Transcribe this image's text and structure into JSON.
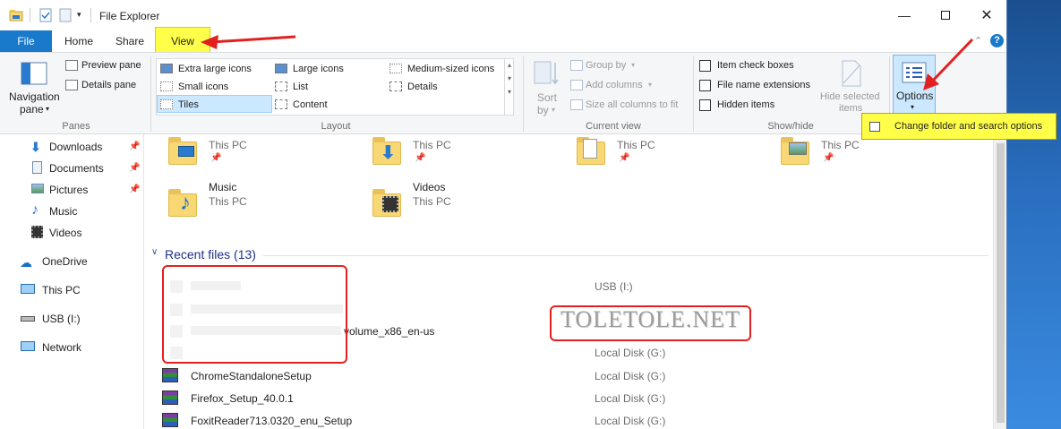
{
  "window": {
    "title": "File Explorer"
  },
  "tabs": {
    "file": "File",
    "home": "Home",
    "share": "Share",
    "view": "View"
  },
  "ribbon": {
    "panes": {
      "label": "Panes",
      "navigation_pane": "Navigation",
      "navigation_pane_2": "pane",
      "preview_pane": "Preview pane",
      "details_pane": "Details pane"
    },
    "layout": {
      "label": "Layout",
      "items": [
        "Extra large icons",
        "Large icons",
        "Medium-sized icons",
        "Small icons",
        "List",
        "Details",
        "Tiles",
        "Content"
      ]
    },
    "current_view": {
      "label": "Current view",
      "sort_by": "Sort",
      "sort_by_2": "by",
      "group_by": "Group by",
      "add_columns": "Add columns",
      "size_all_columns": "Size all columns to fit"
    },
    "show_hide": {
      "label": "Show/hide",
      "item_check_boxes": "Item check boxes",
      "file_name_extensions": "File name extensions",
      "hidden_items": "Hidden items",
      "hide_selected": "Hide selected",
      "hide_selected_2": "items"
    },
    "options": {
      "label": "Options",
      "tooltip": "Change folder and search options"
    }
  },
  "nav": {
    "items": [
      "Downloads",
      "Documents",
      "Pictures",
      "Music",
      "Videos",
      "OneDrive",
      "This PC",
      "USB (I:)",
      "Network"
    ]
  },
  "content": {
    "tiles": [
      {
        "name": "",
        "sub": "This PC"
      },
      {
        "name": "",
        "sub": "This PC"
      },
      {
        "name": "",
        "sub": "This PC"
      },
      {
        "name": "",
        "sub": "This PC"
      },
      {
        "name": "Music",
        "sub": "This PC"
      },
      {
        "name": "Videos",
        "sub": "This PC"
      }
    ],
    "recent_header": "Recent files (13)",
    "recent_files": [
      {
        "name": "",
        "location": "USB (I:)"
      },
      {
        "name": "volume_x86_en-us",
        "location": ""
      },
      {
        "name": "",
        "location": "Local Disk (G:)"
      },
      {
        "name": "ChromeStandaloneSetup",
        "location": "Local Disk (G:)"
      },
      {
        "name": "Firefox_Setup_40.0.1",
        "location": "Local Disk (G:)"
      },
      {
        "name": "FoxitReader713.0320_enu_Setup",
        "location": "Local Disk (G:)"
      }
    ]
  },
  "watermark": "TOLETOLE.NET",
  "colors": {
    "file_tab": "#1979ca",
    "highlight": "#ffff4a",
    "annotation": "#e32020",
    "selected": "#cce8ff"
  }
}
